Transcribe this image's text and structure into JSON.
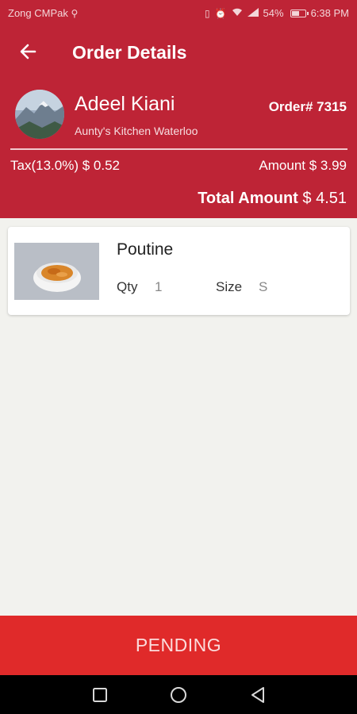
{
  "status_bar": {
    "carrier": "Zong CMPak",
    "battery_percent": "54%",
    "battery_level": 0.54,
    "time": "6:38 PM",
    "icons": [
      "usb-icon",
      "vibrate-icon",
      "alarm-icon",
      "wifi-icon",
      "signal-icon",
      "battery-icon"
    ]
  },
  "header": {
    "title": "Order Details",
    "back_icon": "arrow-left-icon",
    "customer_name": "Adeel Kiani",
    "restaurant": "Aunty's Kitchen Waterloo",
    "order_number": "Order# 7315",
    "tax_label": "Tax(13.0%)",
    "tax_value": "$ 0.52",
    "amount_label": "Amount",
    "amount_value": "$ 3.99",
    "total_label": "Total Amount",
    "total_value": "$ 4.51"
  },
  "items": [
    {
      "name": "Poutine",
      "qty_label": "Qty",
      "qty": "1",
      "size_label": "Size",
      "size": "S"
    }
  ],
  "action": {
    "status_button": "PENDING"
  },
  "colors": {
    "header_red": "#be2436",
    "button_red": "#e02a2a",
    "background": "#f2f2ee"
  },
  "nav_bar": {
    "icons": [
      "recent-apps-icon",
      "home-icon",
      "back-triangle-icon"
    ]
  }
}
